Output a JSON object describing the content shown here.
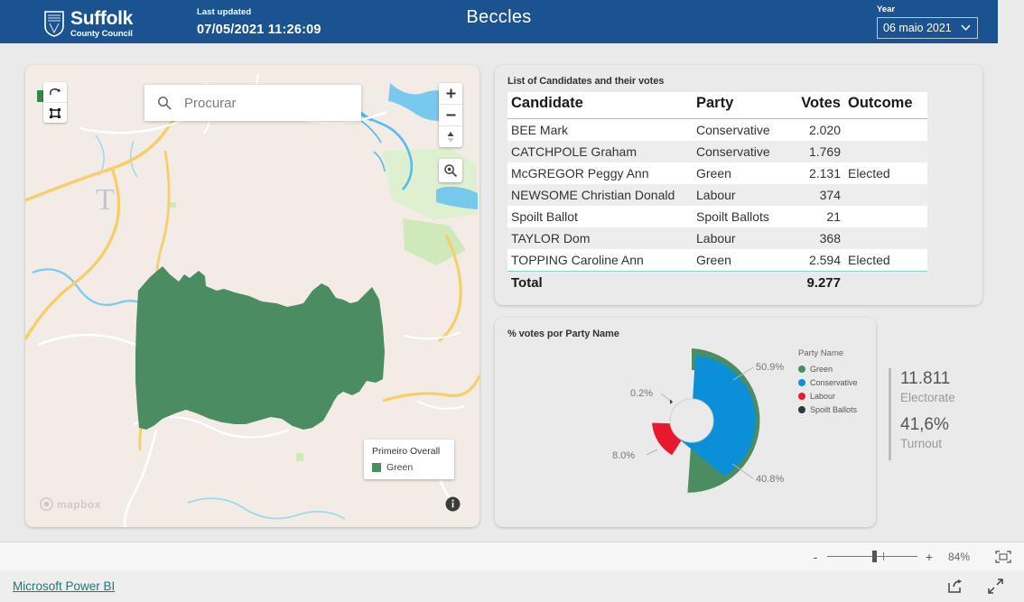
{
  "header": {
    "logo_title": "Suffolk",
    "logo_sub": "County Council",
    "last_updated_label": "Last updated",
    "last_updated_value": "07/05/2021 11:26:09",
    "report_title": "Beccles",
    "year_label": "Year",
    "year_value": "06 maio 2021",
    "bar_color": "#1b5390"
  },
  "map": {
    "search_placeholder": "Procurar",
    "legend_title": "Primeiro Overall",
    "legend_item": "Green",
    "legend_color": "#4c8c63",
    "attribution": "mapbox",
    "tools": [
      "pan-hand-icon",
      "select-box-icon"
    ],
    "zoom_in": "+",
    "zoom_out": "−",
    "area_fill": "#4c8c63"
  },
  "table": {
    "title": "List of Candidates and their votes",
    "columns": [
      "Candidate",
      "Party",
      "Votes",
      "Outcome"
    ],
    "rows": [
      {
        "candidate": "BEE Mark",
        "party": "Conservative",
        "votes": "2.020",
        "outcome": ""
      },
      {
        "candidate": "CATCHPOLE Graham",
        "party": "Conservative",
        "votes": "1.769",
        "outcome": ""
      },
      {
        "candidate": "McGREGOR Peggy Ann",
        "party": "Green",
        "votes": "2.131",
        "outcome": "Elected"
      },
      {
        "candidate": "NEWSOME Christian Donald",
        "party": "Labour",
        "votes": "374",
        "outcome": ""
      },
      {
        "candidate": "Spoilt Ballot",
        "party": "Spoilt Ballots",
        "votes": "21",
        "outcome": ""
      },
      {
        "candidate": "TAYLOR Dom",
        "party": "Labour",
        "votes": "368",
        "outcome": ""
      },
      {
        "candidate": "TOPPING Caroline Ann",
        "party": "Green",
        "votes": "2.594",
        "outcome": "Elected"
      }
    ],
    "total_label": "Total",
    "total_votes": "9.277"
  },
  "chart_data": {
    "type": "pie",
    "title": "% votes por Party Name",
    "legend_title": "Party Name",
    "legend_position": "right",
    "categories": [
      "Green",
      "Conservative",
      "Labour",
      "Spoilt Ballots"
    ],
    "values": [
      50.9,
      40.8,
      8.0,
      0.2
    ],
    "labels": [
      "50.9%",
      "40.8%",
      "8.0%",
      "0.2%"
    ],
    "colors": [
      "#4c8c63",
      "#0a8fd8",
      "#e8192c",
      "#2b3a3f"
    ],
    "xlabel": "",
    "ylabel": "",
    "note": "radial (nightingale) donut - slice radius scales with value"
  },
  "kpi": {
    "electorate_value": "11.811",
    "electorate_label": "Electorate",
    "turnout_value": "41,6%",
    "turnout_label": "Turnout"
  },
  "statusbar": {
    "zoom_out": "-",
    "zoom_in": "+",
    "zoom_level": "84%"
  },
  "footer": {
    "powerbi_link": "Microsoft Power BI"
  }
}
